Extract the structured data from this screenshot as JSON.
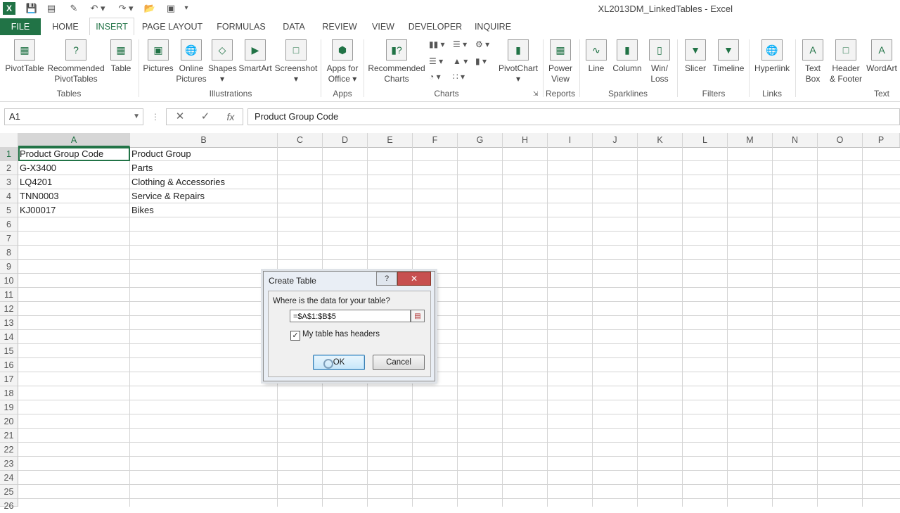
{
  "window": {
    "title": "XL2013DM_LinkedTables - Excel"
  },
  "qat": {
    "logo": "X",
    "customize": "▾"
  },
  "tabs": [
    "FILE",
    "HOME",
    "INSERT",
    "PAGE LAYOUT",
    "FORMULAS",
    "DATA",
    "REVIEW",
    "VIEW",
    "DEVELOPER",
    "INQUIRE"
  ],
  "ribbon": {
    "tables": {
      "label": "Tables",
      "pivot": "PivotTable",
      "recommended": "Recommended",
      "recommended2": "PivotTables",
      "table": "Table"
    },
    "illustrations": {
      "label": "Illustrations",
      "pictures": "Pictures",
      "online": "Online",
      "online2": "Pictures",
      "shapes": "Shapes",
      "smartart": "SmartArt",
      "screenshot": "Screenshot"
    },
    "apps": {
      "label": "Apps",
      "apps": "Apps for",
      "apps2": "Office"
    },
    "charts": {
      "label": "Charts",
      "recommended": "Recommended",
      "recommended2": "Charts",
      "pivotchart": "PivotChart"
    },
    "reports": {
      "label": "Reports",
      "power": "Power",
      "power2": "View"
    },
    "sparklines": {
      "label": "Sparklines",
      "line": "Line",
      "column": "Column",
      "winloss": "Win/",
      "winloss2": "Loss"
    },
    "filters": {
      "label": "Filters",
      "slicer": "Slicer",
      "timeline": "Timeline"
    },
    "links": {
      "label": "Links",
      "hyperlink": "Hyperlink"
    },
    "text": {
      "label": "Text",
      "textbox": "Text",
      "textbox2": "Box",
      "header": "Header",
      "header2": "& Footer",
      "wordart": "WordArt"
    }
  },
  "formula_bar": {
    "name_box": "A1",
    "cancel": "✕",
    "enter": "✓",
    "fx": "fx",
    "content": "Product Group Code"
  },
  "columns": [
    "A",
    "B",
    "C",
    "D",
    "E",
    "F",
    "G",
    "H",
    "I",
    "J",
    "K",
    "L",
    "M",
    "N",
    "O",
    "P"
  ],
  "rows": [
    "1",
    "2",
    "3",
    "4",
    "5",
    "6",
    "7",
    "8",
    "9",
    "10",
    "11",
    "12",
    "13",
    "14",
    "15",
    "16",
    "17",
    "18",
    "19",
    "20",
    "21",
    "22",
    "23",
    "24",
    "25",
    "26"
  ],
  "cells": {
    "r1": {
      "a": "Product Group Code",
      "b": "Product Group"
    },
    "r2": {
      "a": "G-X3400",
      "b": "Parts"
    },
    "r3": {
      "a": "LQ4201",
      "b": "Clothing & Accessories"
    },
    "r4": {
      "a": "TNN0003",
      "b": "Service & Repairs"
    },
    "r5": {
      "a": "KJ00017",
      "b": "Bikes"
    }
  },
  "dialog": {
    "title": "Create Table",
    "help": "?",
    "close": "✕",
    "question": "Where is the data for your table?",
    "range": "=$A$1:$B$5",
    "checkbox_mark": "✓",
    "checkbox_label": "My table has headers",
    "ok": "OK",
    "cancel": "Cancel"
  }
}
